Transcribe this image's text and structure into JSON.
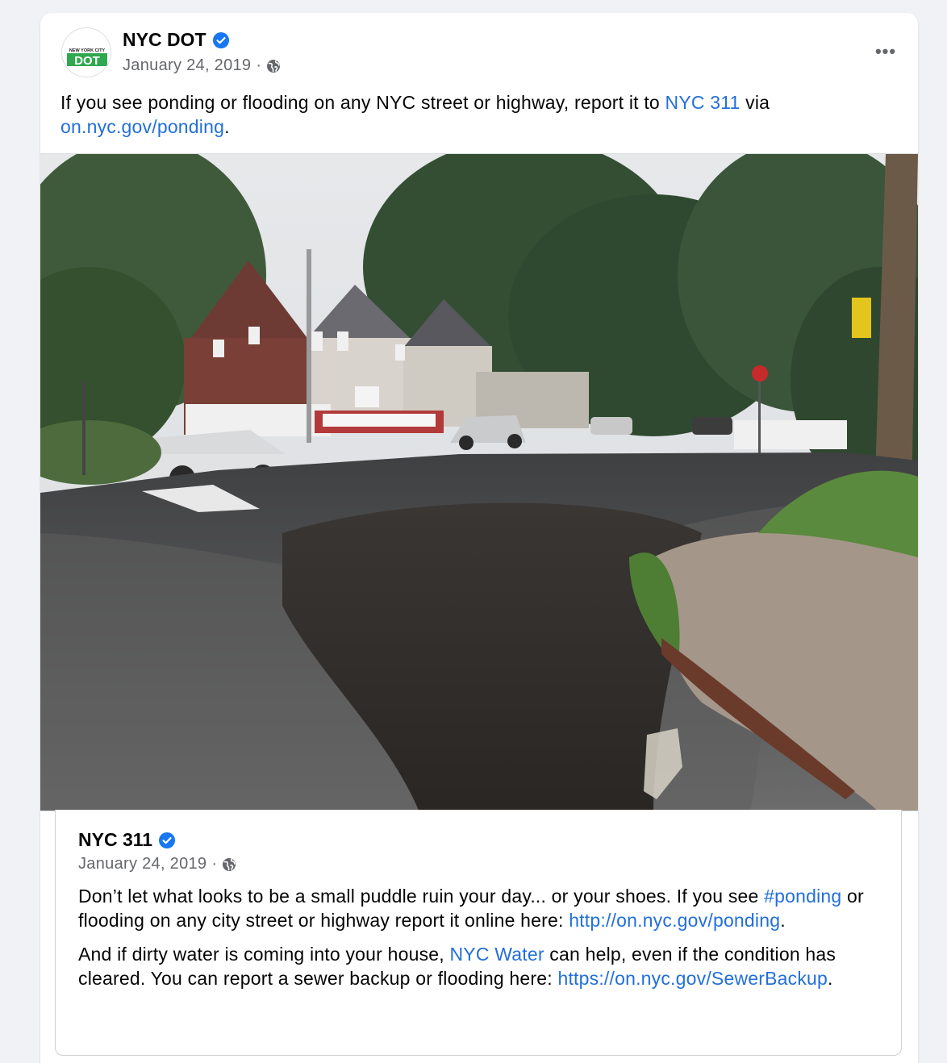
{
  "post": {
    "page_name": "NYC DOT",
    "date": "January 24, 2019",
    "meta_separator": "·",
    "more_label": "•••",
    "logo_text_top": "NEW YORK CITY",
    "logo_text_main": "DOT",
    "text": {
      "part1": "If you see ponding or flooding on any NYC street or highway, report it to ",
      "link1": "NYC 311",
      "part2": " via ",
      "link2": "on.nyc.gov/ponding",
      "part3": "."
    },
    "photo_icon": "street-flooding-photo"
  },
  "shared": {
    "page_name": "NYC 311",
    "date": "January 24, 2019",
    "meta_separator": "·",
    "para1": {
      "part1": "Don’t let what looks to be a small puddle ruin your day... or your shoes. If you see ",
      "hashtag": "#ponding",
      "part2": " or flooding on any city street or highway report it online here: ",
      "link": "http://on.nyc.gov/ponding",
      "part3": "."
    },
    "para2": {
      "part1": "And if dirty water is coming into your house, ",
      "link1": "NYC Water",
      "part2": " can help, even if the condition has cleared. You can report a sewer backup or flooding here: ",
      "link2": "https://on.nyc.gov/SewerBackup",
      "part3": "."
    }
  },
  "colors": {
    "link": "#216fdb",
    "verified": "#1877f2",
    "meta": "#65676b",
    "logo_green": "#2fa84f"
  }
}
